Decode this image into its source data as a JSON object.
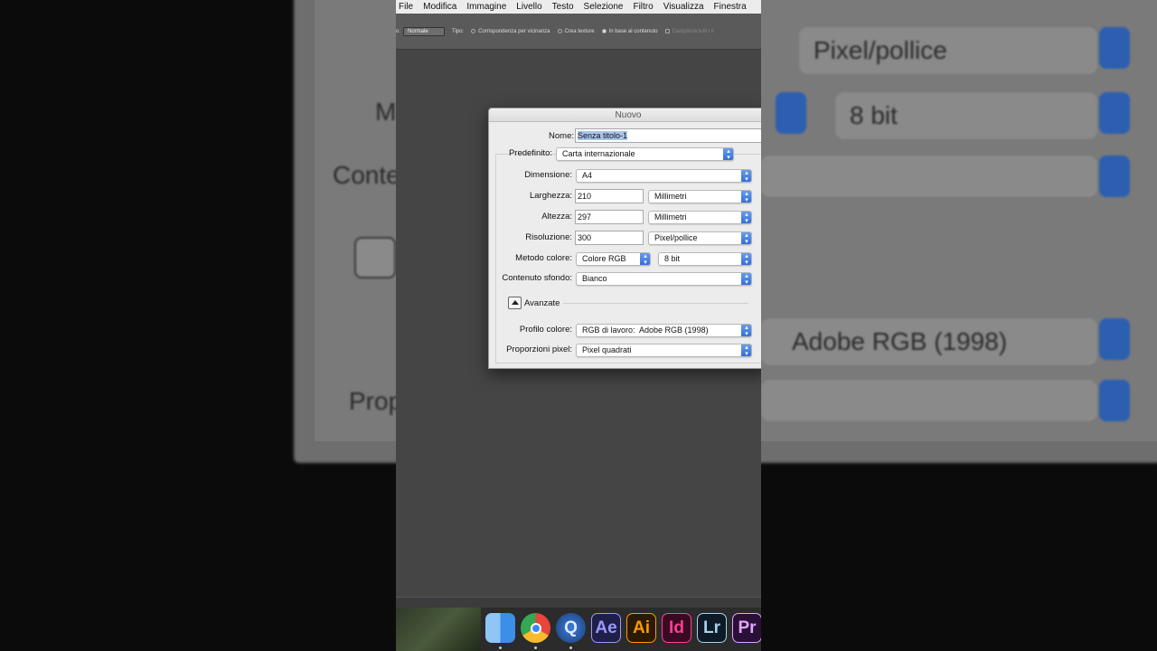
{
  "background": {
    "zoom_fields": [
      "Pixel/pollice",
      "8 bit",
      "Adobe RGB (1998)"
    ],
    "zoom_labels": [
      "M",
      "Conte",
      "Prop"
    ]
  },
  "menubar": {
    "items": [
      "File",
      "Modifica",
      "Immagine",
      "Livello",
      "Testo",
      "Selezione",
      "Filtro",
      "Visualizza",
      "Finestra"
    ]
  },
  "options_bar": {
    "mode_label": "o:",
    "mode_value": "Normale",
    "type_label": "Tipo:",
    "radio1": "Corrispondenza per vicinanza",
    "radio2": "Crea texture",
    "radio3": "In base al contenuto",
    "checkbox": "Campiona tutti i li"
  },
  "dialog": {
    "title": "Nuovo",
    "name_label": "Nome:",
    "name_value": "Senza titolo-1",
    "preset_label": "Predefinito:",
    "preset_value": "Carta internazionale",
    "size_label": "Dimensione:",
    "size_value": "A4",
    "width_label": "Larghezza:",
    "width_value": "210",
    "width_unit": "Millimetri",
    "height_label": "Altezza:",
    "height_value": "297",
    "height_unit": "Millimetri",
    "resolution_label": "Risoluzione:",
    "resolution_value": "300",
    "resolution_unit": "Pixel/pollice",
    "color_mode_label": "Metodo colore:",
    "color_mode_value": "Colore RGB",
    "bit_depth_value": "8 bit",
    "background_label": "Contenuto sfondo:",
    "background_value": "Bianco",
    "advanced_label": "Avanzate",
    "color_profile_label": "Profilo colore:",
    "color_profile_value": "RGB di lavoro:  Adobe RGB (1998)",
    "pixel_aspect_label": "Proporzioni pixel:",
    "pixel_aspect_value": "Pixel quadrati"
  },
  "dock": {
    "apps": [
      {
        "name": "Finder",
        "glyph": "",
        "color": "#3d8ee6"
      },
      {
        "name": "Chrome",
        "glyph": "",
        "color": "#e8453c"
      },
      {
        "name": "QuickTime",
        "glyph": "Q",
        "color": "#2a5ea8"
      },
      {
        "name": "After Effects",
        "glyph": "Ae",
        "color": "#9999ff"
      },
      {
        "name": "Illustrator",
        "glyph": "Ai",
        "color": "#ff9a00"
      },
      {
        "name": "InDesign",
        "glyph": "Id",
        "color": "#ff3f94"
      },
      {
        "name": "Lightroom",
        "glyph": "Lr",
        "color": "#a8d1f0"
      },
      {
        "name": "Premiere",
        "glyph": "Pr",
        "color": "#e1a6ff"
      }
    ]
  }
}
